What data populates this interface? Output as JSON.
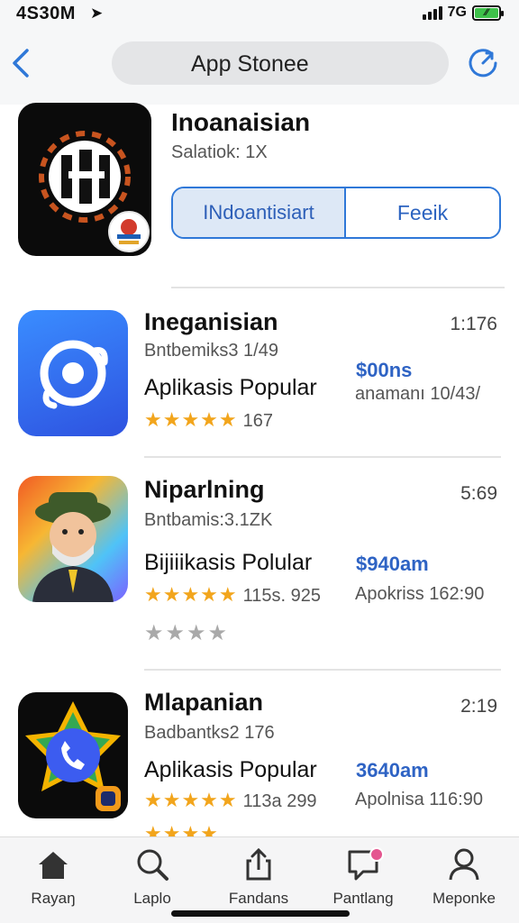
{
  "status": {
    "time": "4S30M",
    "network": "7G"
  },
  "nav": {
    "title": "App Stonee"
  },
  "featured": {
    "name": "Inoanaisian",
    "subtitle": "Salatiok: 1X",
    "segment_left": "INdoantisiart",
    "segment_right": "Feeik"
  },
  "apps": [
    {
      "name": "Ineganisian",
      "dev": "Bntbemiks3 1/49",
      "category": "Aplikasis Popular",
      "rating_count": "167",
      "time": "1:176",
      "price": "$00ns",
      "extra": "anamanı 10/43/",
      "colors": [
        "#2f6ff0",
        "#3b5ce8"
      ]
    },
    {
      "name": "Niparlning",
      "dev": "Bntbamis:3.1ZK",
      "category": "Bijiiikasis Polular",
      "rating_count": "115s. 925",
      "time": "5:69",
      "price": "$940am",
      "extra": "Apokriss 162:90"
    },
    {
      "name": "Mlapanian",
      "dev": "Badbantks2 176",
      "category": "Aplikasis Popular",
      "rating_count": "113a 299",
      "time": "2:19",
      "price": "3640am",
      "extra": "Apolnisa 116:90"
    }
  ],
  "tabs": [
    {
      "label": "Rayaŋ",
      "icon": "home-icon"
    },
    {
      "label": "Laplo",
      "icon": "search-icon"
    },
    {
      "label": "Fandans",
      "icon": "share-icon"
    },
    {
      "label": "Pantlang",
      "icon": "chat-icon"
    },
    {
      "label": "Meponke",
      "icon": "person-icon"
    }
  ],
  "colors": {
    "accent": "#2f78d8",
    "star": "#f2a51c",
    "notification": "#e4558f"
  }
}
